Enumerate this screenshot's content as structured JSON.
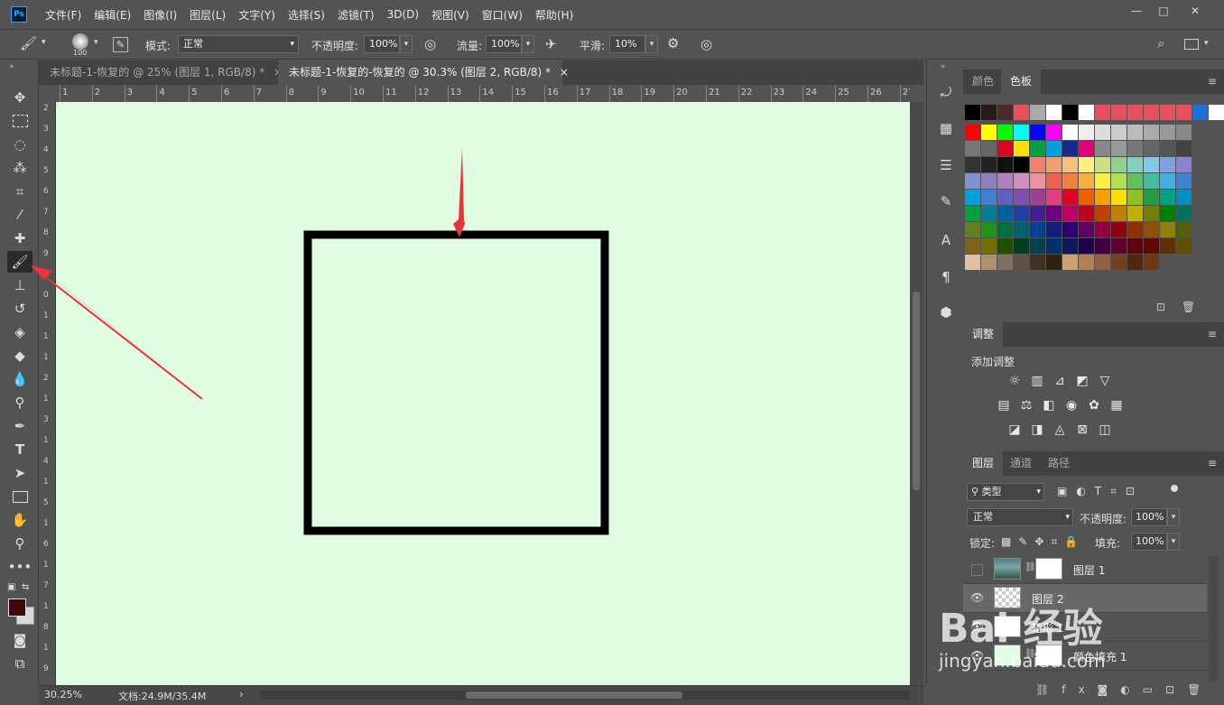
{
  "app": {
    "logo": "Ps"
  },
  "menu": [
    "文件(F)",
    "编辑(E)",
    "图像(I)",
    "图层(L)",
    "文字(Y)",
    "选择(S)",
    "滤镜(T)",
    "3D(D)",
    "视图(V)",
    "窗口(W)",
    "帮助(H)"
  ],
  "window_controls": [
    "—",
    "□",
    "✕"
  ],
  "options": {
    "brush_size": "100",
    "mode_label": "模式:",
    "mode_value": "正常",
    "opacity_label": "不透明度:",
    "opacity_value": "100%",
    "flow_label": "流量:",
    "flow_value": "100%",
    "smooth_label": "平滑:",
    "smooth_value": "10%"
  },
  "tabs": [
    {
      "label": "未标题-1-恢复的 @ 25% (图层 1, RGB/8) *",
      "close": "×"
    },
    {
      "label": "未标题-1-恢复的-恢复的 @ 30.3% (图层 2, RGB/8) *",
      "close": "×"
    }
  ],
  "ruler_h_labels": [
    "1",
    "2",
    "3",
    "4",
    "5",
    "6",
    "7",
    "8",
    "9",
    "10",
    "11",
    "12",
    "13",
    "14",
    "15",
    "16",
    "17",
    "18",
    "19",
    "20",
    "21",
    "22",
    "23",
    "24",
    "25",
    "26",
    "27"
  ],
  "ruler_v_labels": [
    "2",
    "3",
    "4",
    "5",
    "6",
    "7",
    "8",
    "9",
    "1",
    "0",
    "1",
    "1",
    "1",
    "2",
    "1",
    "3",
    "1",
    "4",
    "1",
    "5",
    "1",
    "6",
    "1",
    "7",
    "1",
    "8",
    "1",
    "9"
  ],
  "status": {
    "zoom": "30.25%",
    "doc": "文档:24.9M/35.4M",
    "arrow": "›"
  },
  "panels": {
    "color_tabs": [
      "颜色",
      "色板"
    ],
    "adjust_tab": "调整",
    "adjust_title": "添加调整",
    "layers_tabs": [
      "图层",
      "通道",
      "路径"
    ],
    "filter_kind": "类型",
    "blend_mode": "正常",
    "opacity_label": "不透明度:",
    "opacity_value": "100%",
    "lock_label": "锁定:",
    "fill_label": "填充:",
    "fill_value": "100%",
    "layers": [
      {
        "name": "图层 1"
      },
      {
        "name": "图层 2"
      },
      {
        "name": "矩形 1"
      },
      {
        "name": "颜色填充 1"
      }
    ]
  },
  "watermark": {
    "brand": "Bai 经验",
    "url": "jingyan.baidu.com"
  },
  "colors": {
    "canvas": "#e1fde1",
    "arrow": "#e8343a",
    "rect_stroke": "#000000"
  },
  "icons": {
    "tools": [
      "move-icon",
      "marquee-icon",
      "lasso-icon",
      "magic-wand-icon",
      "crop-icon",
      "eyedropper-icon",
      "healing-icon",
      "brush-icon",
      "stamp-icon",
      "history-brush-icon",
      "eraser-icon",
      "bucket-icon",
      "blur-icon",
      "dodge-icon",
      "pen-icon",
      "type-icon",
      "path-select-icon",
      "rectangle-icon",
      "hand-icon",
      "zoom-icon",
      "more-icon"
    ]
  }
}
